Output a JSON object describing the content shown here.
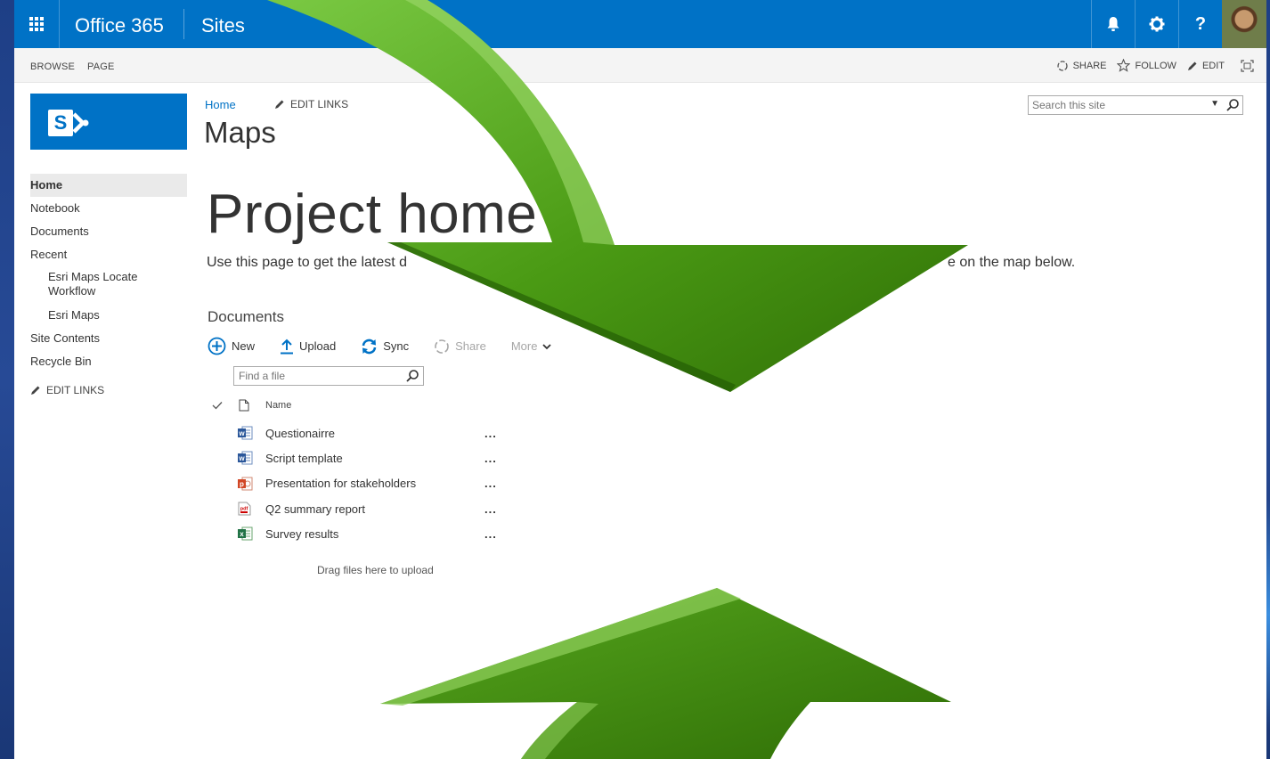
{
  "suite_bar": {
    "brand": "Office 365",
    "app": "Sites",
    "help_glyph": "?"
  },
  "ribbon": {
    "tabs": [
      "BROWSE",
      "PAGE"
    ],
    "actions": {
      "share": "SHARE",
      "follow": "FOLLOW",
      "edit": "EDIT"
    }
  },
  "logo": {
    "letter": "S"
  },
  "left_nav": {
    "items": [
      {
        "label": "Home",
        "active": true
      },
      {
        "label": "Notebook"
      },
      {
        "label": "Documents"
      },
      {
        "label": "Recent"
      },
      {
        "label": "Esri Maps Locate Workflow",
        "sub": true
      },
      {
        "label": "Esri Maps",
        "sub": true
      },
      {
        "label": "Site Contents"
      },
      {
        "label": "Recycle Bin"
      }
    ],
    "edit_links": "EDIT LINKS"
  },
  "header": {
    "breadcrumb": "Home",
    "edit_links": "EDIT LINKS",
    "page_title": "Maps"
  },
  "search": {
    "placeholder": "Search this site"
  },
  "main": {
    "project_title": "Project home",
    "lead_text_start": "Use this page to get the latest d",
    "lead_text_end": "e on the map below.",
    "documents_heading": "Documents",
    "commands": {
      "new": "New",
      "upload": "Upload",
      "sync": "Sync",
      "share": "Share",
      "more": "More"
    },
    "find_file_placeholder": "Find a file",
    "column_name": "Name",
    "files": [
      {
        "name": "Questionairre",
        "type": "word"
      },
      {
        "name": "Script template",
        "type": "word"
      },
      {
        "name": "Presentation for stakeholders",
        "type": "powerpoint"
      },
      {
        "name": "Q2 summary report",
        "type": "pdf"
      },
      {
        "name": "Survey results",
        "type": "excel"
      }
    ],
    "more_glyph": "...",
    "drag_hint": "Drag files here to upload"
  },
  "colors": {
    "suite_blue": "#0072c6",
    "arrow_green": "#3e8a0c",
    "background_blue": "#274a96"
  }
}
